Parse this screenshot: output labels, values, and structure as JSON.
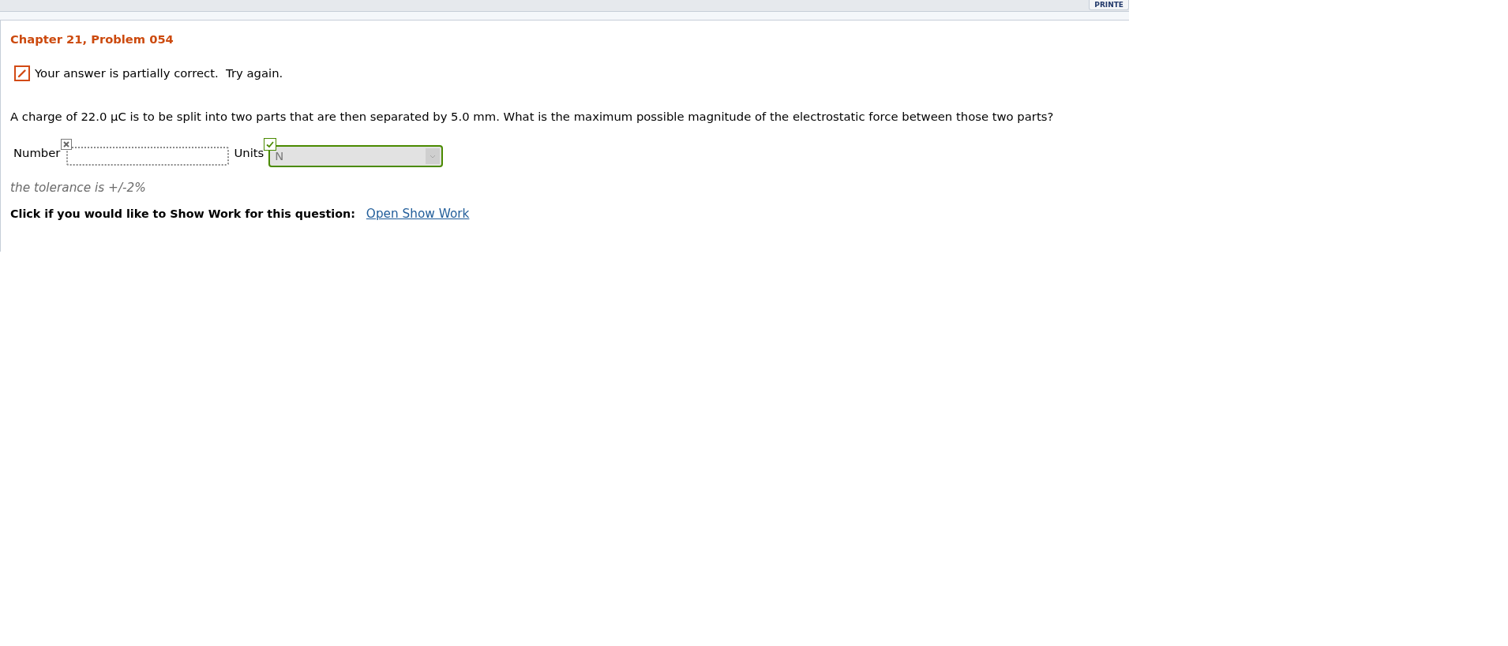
{
  "top_bar": {
    "button": "PRINTE"
  },
  "problem": {
    "title": "Chapter 21, Problem 054",
    "feedback": {
      "kind": "partial",
      "text": "Your answer is partially correct.  Try again."
    },
    "question": "A charge of 22.0 μC is to be split into two parts that are then separated by 5.0 mm. What is the maximum possible magnitude of the electrostatic force between those two parts?",
    "answers": [
      {
        "label": "Number",
        "kind": "input",
        "correct": false
      },
      {
        "label": "Units",
        "kind": "select",
        "value": "N",
        "correct": true,
        "disabled": true
      }
    ],
    "tolerance": "the tolerance is +/-2%",
    "show_work": {
      "prompt": "Click if you would like to Show Work for this question:",
      "link": "Open Show Work"
    }
  }
}
